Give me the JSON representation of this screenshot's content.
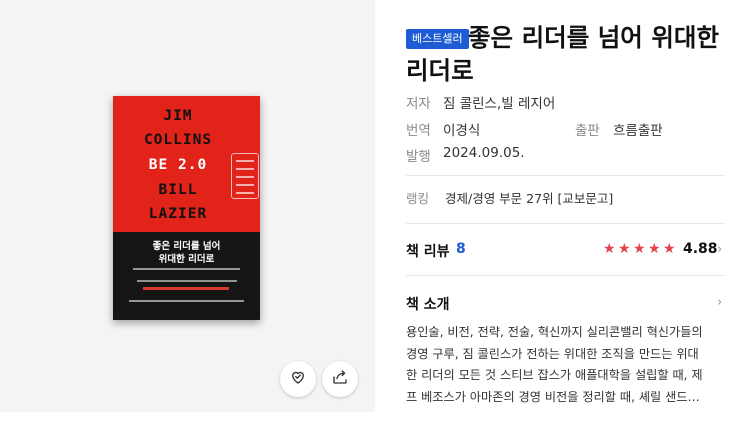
{
  "badge": "베스트셀러",
  "title": "좋은 리더를 넘어 위대한 리더로",
  "meta": {
    "author_label": "저자",
    "author_value": "짐 콜린스,빌 레지어",
    "translator_label": "번역",
    "translator_value": "이경식",
    "publisher_label": "출판",
    "publisher_value": "흐름출판",
    "date_label": "발행",
    "date_value": "2024.09.05."
  },
  "ranking": {
    "label": "랭킹",
    "value": "경제/경영 부문 27위 [교보문고]"
  },
  "review": {
    "label": "책 리뷰",
    "count": "8",
    "rating": "4.88",
    "stars": 5
  },
  "intro": {
    "label": "책 소개",
    "lines": [
      "용인술, 비전, 전략, 전술, 혁신까지 실리콘밸리 혁신가들의",
      "경영 구루, 짐 콜린스가 전하는 위대한 조직을 만드는 위대",
      "한 리더의 모든 것 스티브 잡스가 애플대학을 설립할 때, 제",
      "프 베조스가 아마존의 경영 비전을 정리할 때, 셰릴 샌드…"
    ]
  },
  "cover": {
    "author_1": "JIM",
    "author_2": "COLLINS",
    "subtitle": "BE 2.0",
    "author_3": "BILL",
    "author_4": "LAZIER",
    "title_1": "좋은 리더를 넘어",
    "title_2": "위대한 리더로"
  },
  "icons": {
    "wishlist": "heart-check-icon",
    "share": "share-icon"
  },
  "colors": {
    "accent": "#1e5cd6",
    "star": "#e4434e",
    "cover_red": "#e2231a"
  }
}
